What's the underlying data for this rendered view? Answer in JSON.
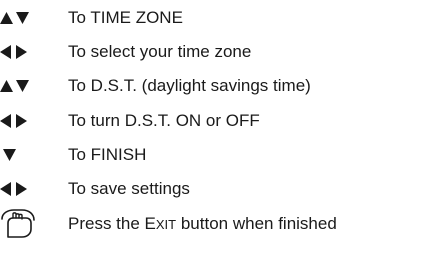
{
  "steps": [
    {
      "icon": "up-down-arrows-icon",
      "text": "To TIME ZONE"
    },
    {
      "icon": "left-right-arrows-icon",
      "text": "To select your time zone"
    },
    {
      "icon": "up-down-arrows-icon",
      "text": "To D.S.T. (daylight savings time)"
    },
    {
      "icon": "left-right-arrows-icon",
      "text": "To turn D.S.T. ON or OFF"
    },
    {
      "icon": "down-arrow-icon",
      "text": "To FINISH"
    },
    {
      "icon": "left-right-arrows-icon",
      "text": "To save settings"
    },
    {
      "icon": "pressing-finger-icon",
      "text_before": "Press the ",
      "button_first": "E",
      "button_rest": "XIT",
      "text_after": " button when finished"
    }
  ]
}
